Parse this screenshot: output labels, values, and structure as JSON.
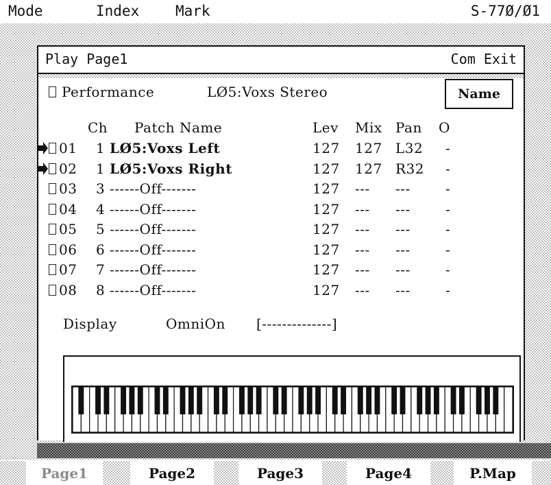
{
  "menubar": {
    "items": [
      "Mode",
      "Index",
      "Mark"
    ],
    "model": "S-77Ø/Ø1"
  },
  "window": {
    "title": "Play Page1",
    "com_exit": "Com Exit"
  },
  "performance": {
    "label": "Performance",
    "value": "LØ5:Voxs Stereo",
    "name_button": "Name"
  },
  "table": {
    "header_ch": "Ch",
    "header_patch": "Patch Name",
    "header_lev": "Lev",
    "header_mix": "Mix",
    "header_pan": "Pan",
    "header_o": "O",
    "rows": [
      {
        "num": "01",
        "ch": "1",
        "patch": "LØ5:Voxs Left",
        "lev": "127",
        "mix": "127",
        "pan": "L32",
        "o": "-",
        "active": true
      },
      {
        "num": "02",
        "ch": "1",
        "patch": "LØ5:Voxs Right",
        "lev": "127",
        "mix": "127",
        "pan": "R32",
        "o": "-",
        "active": true
      },
      {
        "num": "03",
        "ch": "3",
        "patch": "------Off-------",
        "lev": "127",
        "mix": "---",
        "pan": "---",
        "o": "-",
        "active": false
      },
      {
        "num": "04",
        "ch": "4",
        "patch": "------Off-------",
        "lev": "127",
        "mix": "---",
        "pan": "---",
        "o": "-",
        "active": false
      },
      {
        "num": "05",
        "ch": "5",
        "patch": "------Off-------",
        "lev": "127",
        "mix": "---",
        "pan": "---",
        "o": "-",
        "active": false
      },
      {
        "num": "06",
        "ch": "6",
        "patch": "------Off-------",
        "lev": "127",
        "mix": "---",
        "pan": "---",
        "o": "-",
        "active": false
      },
      {
        "num": "07",
        "ch": "7",
        "patch": "------Off-------",
        "lev": "127",
        "mix": "---",
        "pan": "---",
        "o": "-",
        "active": false
      },
      {
        "num": "08",
        "ch": "8",
        "patch": "------Off-------",
        "lev": "127",
        "mix": "---",
        "pan": "---",
        "o": "-",
        "active": false
      }
    ]
  },
  "display": {
    "label": "Display",
    "mode": "OmniOn",
    "value": "[--------------]"
  },
  "tabs": [
    {
      "label": "Page1",
      "selected": true
    },
    {
      "label": "Page2",
      "selected": false
    },
    {
      "label": "Page3",
      "selected": false
    },
    {
      "label": "Page4",
      "selected": false
    },
    {
      "label": "P.Map",
      "selected": false
    }
  ]
}
